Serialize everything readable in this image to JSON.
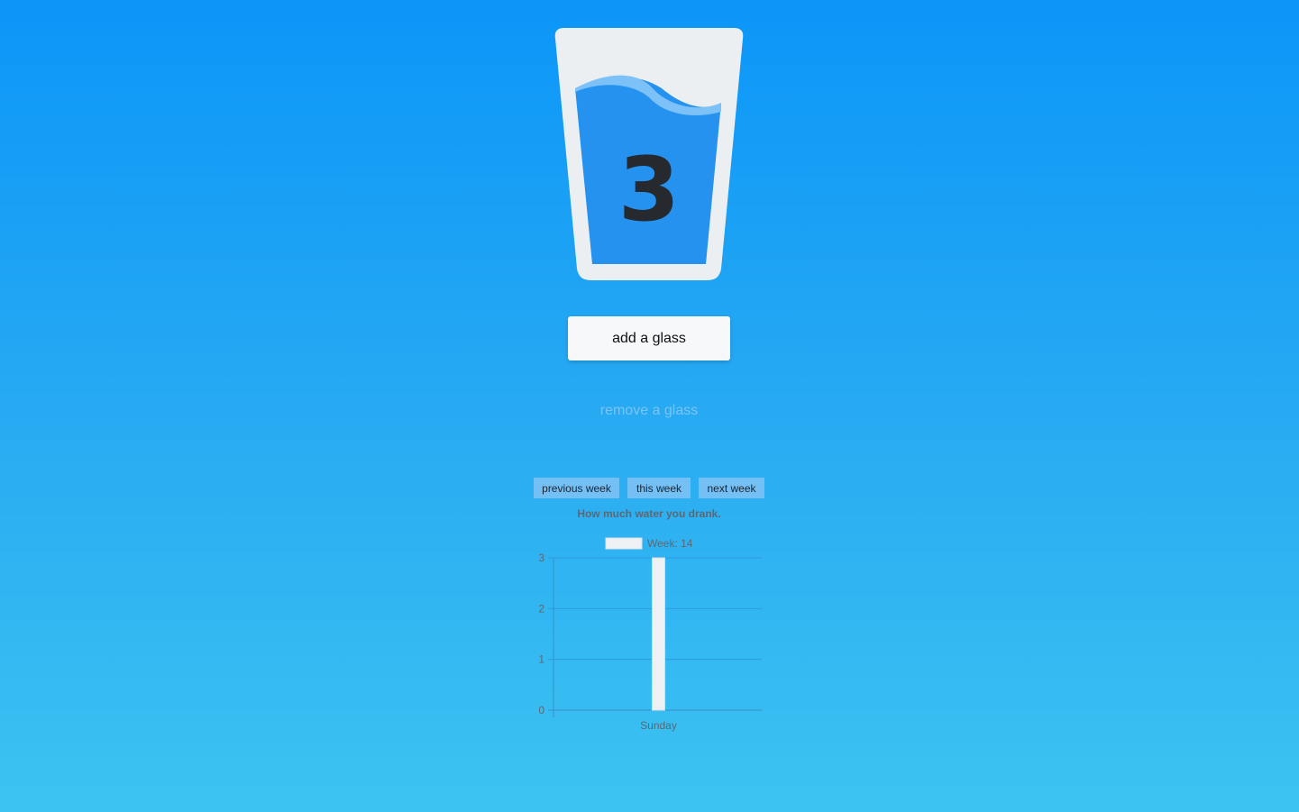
{
  "glass": {
    "count": "3"
  },
  "actions": {
    "add_label": "add a glass",
    "remove_label": "remove a glass"
  },
  "week_nav": {
    "previous_label": "previous week",
    "this_label": "this week",
    "next_label": "next week"
  },
  "colors": {
    "background_top": "#0b96f8",
    "background_bottom": "#3cc3f1",
    "water": "#2592f0",
    "wave": "#7cc2f8",
    "glass": "#eceff1",
    "bar_fill": "#eef1f4",
    "button_tint": "#74bff4"
  },
  "chart_data": {
    "type": "bar",
    "title": "How much water you drank.",
    "categories": [
      "Sunday"
    ],
    "series": [
      {
        "name": "Week: 14",
        "values": [
          3
        ]
      }
    ],
    "ylim": [
      0,
      3
    ],
    "yticks": [
      "0",
      "1",
      "2",
      "3"
    ],
    "grid": true,
    "legend": "top"
  }
}
